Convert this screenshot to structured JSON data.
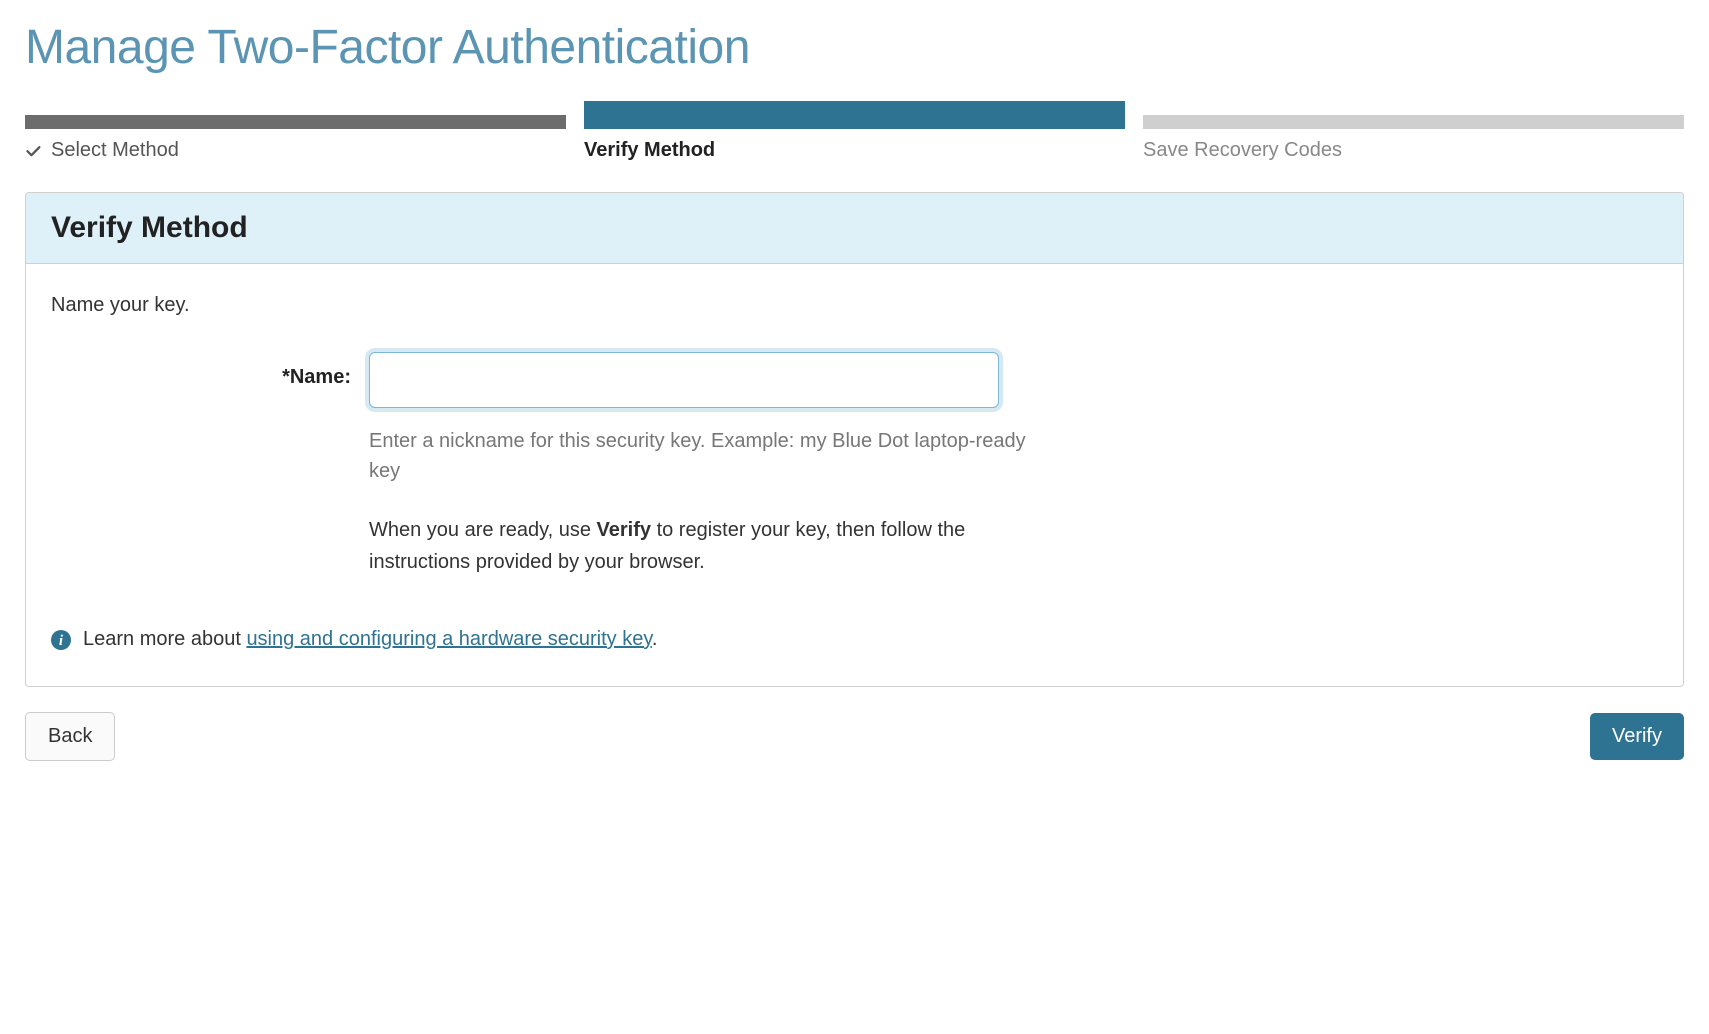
{
  "page": {
    "title": "Manage Two-Factor Authentication"
  },
  "stepper": {
    "steps": [
      {
        "label": "Select Method",
        "state": "complete"
      },
      {
        "label": "Verify Method",
        "state": "active"
      },
      {
        "label": "Save Recovery Codes",
        "state": "upcoming"
      }
    ]
  },
  "panel": {
    "title": "Verify Method",
    "intro": "Name your key.",
    "form": {
      "name_label": "*Name:",
      "name_value": "",
      "name_help": "Enter a nickname for this security key. Example: my Blue Dot laptop-ready key",
      "instruction_pre": "When you are ready, use ",
      "instruction_bold": "Verify",
      "instruction_post": " to register your key, then follow the instructions provided by your browser."
    },
    "learn_more": {
      "prefix": "Learn more about ",
      "link_text": "using and configuring a hardware security key",
      "suffix": "."
    }
  },
  "buttons": {
    "back": "Back",
    "verify": "Verify"
  }
}
